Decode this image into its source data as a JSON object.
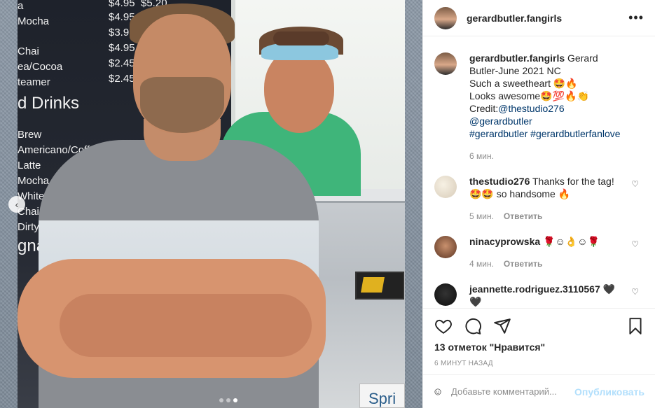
{
  "post": {
    "username": "gerardbutler.fangirls",
    "more": "•••",
    "caption": {
      "username": "gerardbutler.fangirls",
      "line1": "Gerard Butler-June 2021 NC",
      "line2": "Such a sweetheart 🤩🔥",
      "line3": "Looks awesome🤩💯🔥👏",
      "credit_prefix": "Credit:",
      "credit_link": "@thestudio276",
      "mention": "@gerardbutler",
      "tags": "#gerardbutler #gerardbutlerfanlove",
      "time": "6 мин."
    },
    "comments": [
      {
        "username": "thestudio276",
        "text": "Thanks for the tag! 🤩🤩 so handsome 🔥",
        "time": "5 мин.",
        "reply": "Ответить"
      },
      {
        "username": "ninacyprowska",
        "text": "🌹☺👌☺🌹",
        "time": "4 мин.",
        "reply": "Ответить"
      },
      {
        "username": "jeannette.rodriguez.3110567",
        "text": "🖤🖤",
        "time": "",
        "reply": ""
      }
    ],
    "likes": "13 отметок \"Нравится\"",
    "posted": "6 минут назад",
    "comment_placeholder": "Добавьте комментарий...",
    "publish_label": "Опубликовать",
    "carousel": {
      "count": 3,
      "active_index": 2,
      "prev_arrow": "‹"
    }
  },
  "photo": {
    "menu": {
      "prices": [
        "$4.95",
        "$4.95",
        "$3.95",
        "$4.95",
        "$2.45",
        "$2.45"
      ],
      "price_top_right": "$5.20",
      "items_top": [
        "a",
        "Mocha",
        "",
        "Chai",
        "ea/Cocoa",
        "teamer"
      ],
      "section": "d Drinks",
      "items_bottom": [
        "Brew",
        "Americano/Coffee",
        "Latte",
        "Mocha",
        "White M",
        "Chai",
        "Dirty C"
      ],
      "section2": "gna"
    },
    "sign_text": "Spri"
  },
  "icons": {
    "heart": "heart-icon",
    "comment": "comment-icon",
    "share": "share-icon",
    "bookmark": "bookmark-icon",
    "emoji": "emoji-icon"
  },
  "colors": {
    "link": "#00376b",
    "publish": "#b2dffc",
    "muted": "#8e8e8e"
  }
}
